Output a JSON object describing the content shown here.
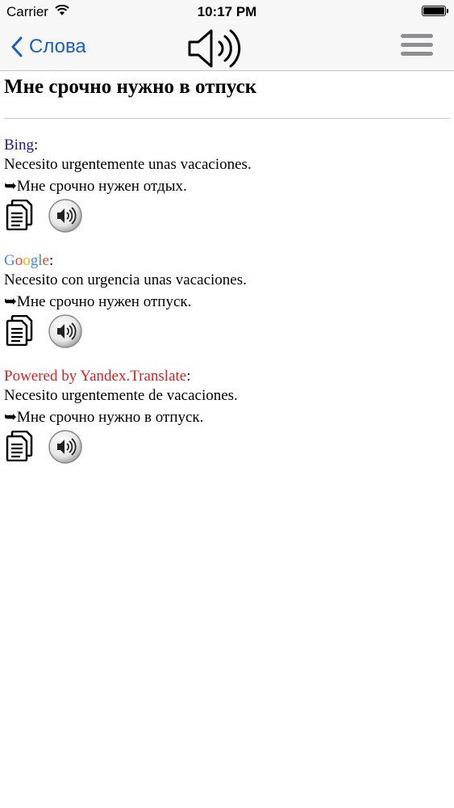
{
  "status_bar": {
    "carrier": "Carrier",
    "time": "10:17 PM"
  },
  "nav": {
    "back_label": "Слова"
  },
  "page_title": "Мне срочно нужно в отпуск",
  "translations": [
    {
      "source": "Bing",
      "source_color": "#1a1aa6",
      "text": "Necesito urgentemente unas vacaciones.",
      "back_translation": "➥Мне срочно нужен отдых."
    },
    {
      "source": "Google",
      "source_letters": [
        "G",
        "o",
        "o",
        "g",
        "l",
        "e"
      ],
      "text": "Necesito con urgencia unas vacaciones.",
      "back_translation": "➥Мне срочно нужен отпуск."
    },
    {
      "source": "Powered by Yandex.Translate",
      "source_color": "#e01f1f",
      "text": "Necesito urgentemente de vacaciones.",
      "back_translation": "➥Мне срочно нужно в отпуск."
    }
  ],
  "colon": ":",
  "icons": {
    "back": "chevron-left-icon",
    "speaker": "speaker-icon",
    "menu": "hamburger-menu-icon",
    "copy": "copy-document-icon",
    "speak": "speaker-button-icon"
  }
}
